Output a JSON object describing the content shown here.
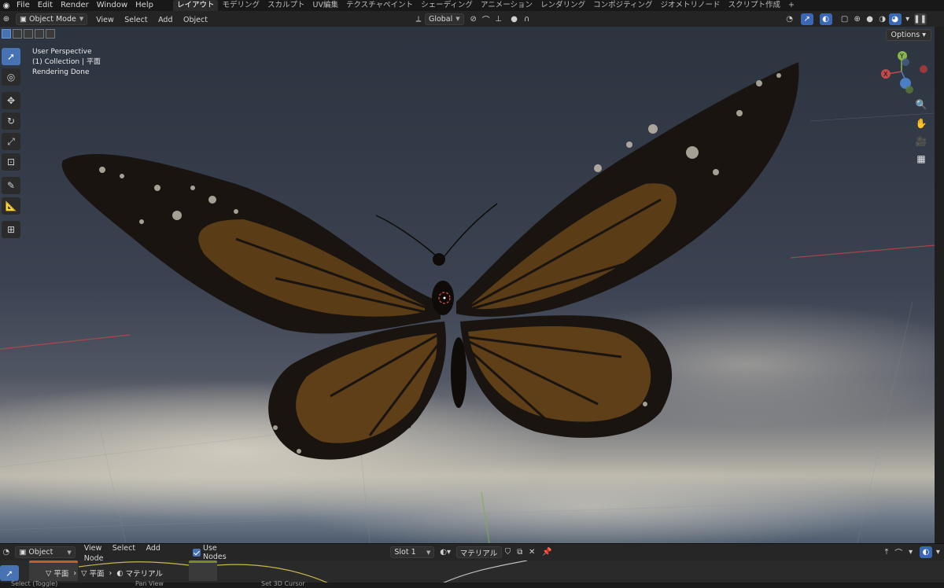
{
  "topbar": {
    "menu": [
      "File",
      "Edit",
      "Render",
      "Window",
      "Help"
    ],
    "workspaces": [
      "レイアウト",
      "モデリング",
      "スカルプト",
      "UV編集",
      "テクスチャペイント",
      "シェーディング",
      "アニメーション",
      "レンダリング",
      "コンポジティング",
      "ジオメトリノード",
      "スクリプト作成",
      "+"
    ],
    "active_workspace": 0
  },
  "viewport_header": {
    "mode": "Object Mode",
    "menu": [
      "View",
      "Select",
      "Add",
      "Object"
    ],
    "transform_orientation": "Global",
    "options_label": "Options"
  },
  "overlay": {
    "line1": "User Perspective",
    "line2": "(1) Collection | 平面",
    "line3": "Rendering Done"
  },
  "gizmo": {
    "y": "Y",
    "x": "X"
  },
  "node_header": {
    "mode": "Object",
    "menu": [
      "View",
      "Select",
      "Add",
      "Node"
    ],
    "use_nodes_label": "Use Nodes",
    "slot": "Slot 1",
    "material": "マテリアル"
  },
  "breadcrumb": {
    "object": "平面",
    "material": "マテリアル"
  },
  "statusbar": {
    "hint1": "Select (Toggle)",
    "hint2": "Pan View",
    "hint3": "Set 3D Cursor"
  },
  "colors": {
    "accent": "#4772b3",
    "wing_orange": "#5a3c16",
    "wing_dark": "#1a1410"
  }
}
